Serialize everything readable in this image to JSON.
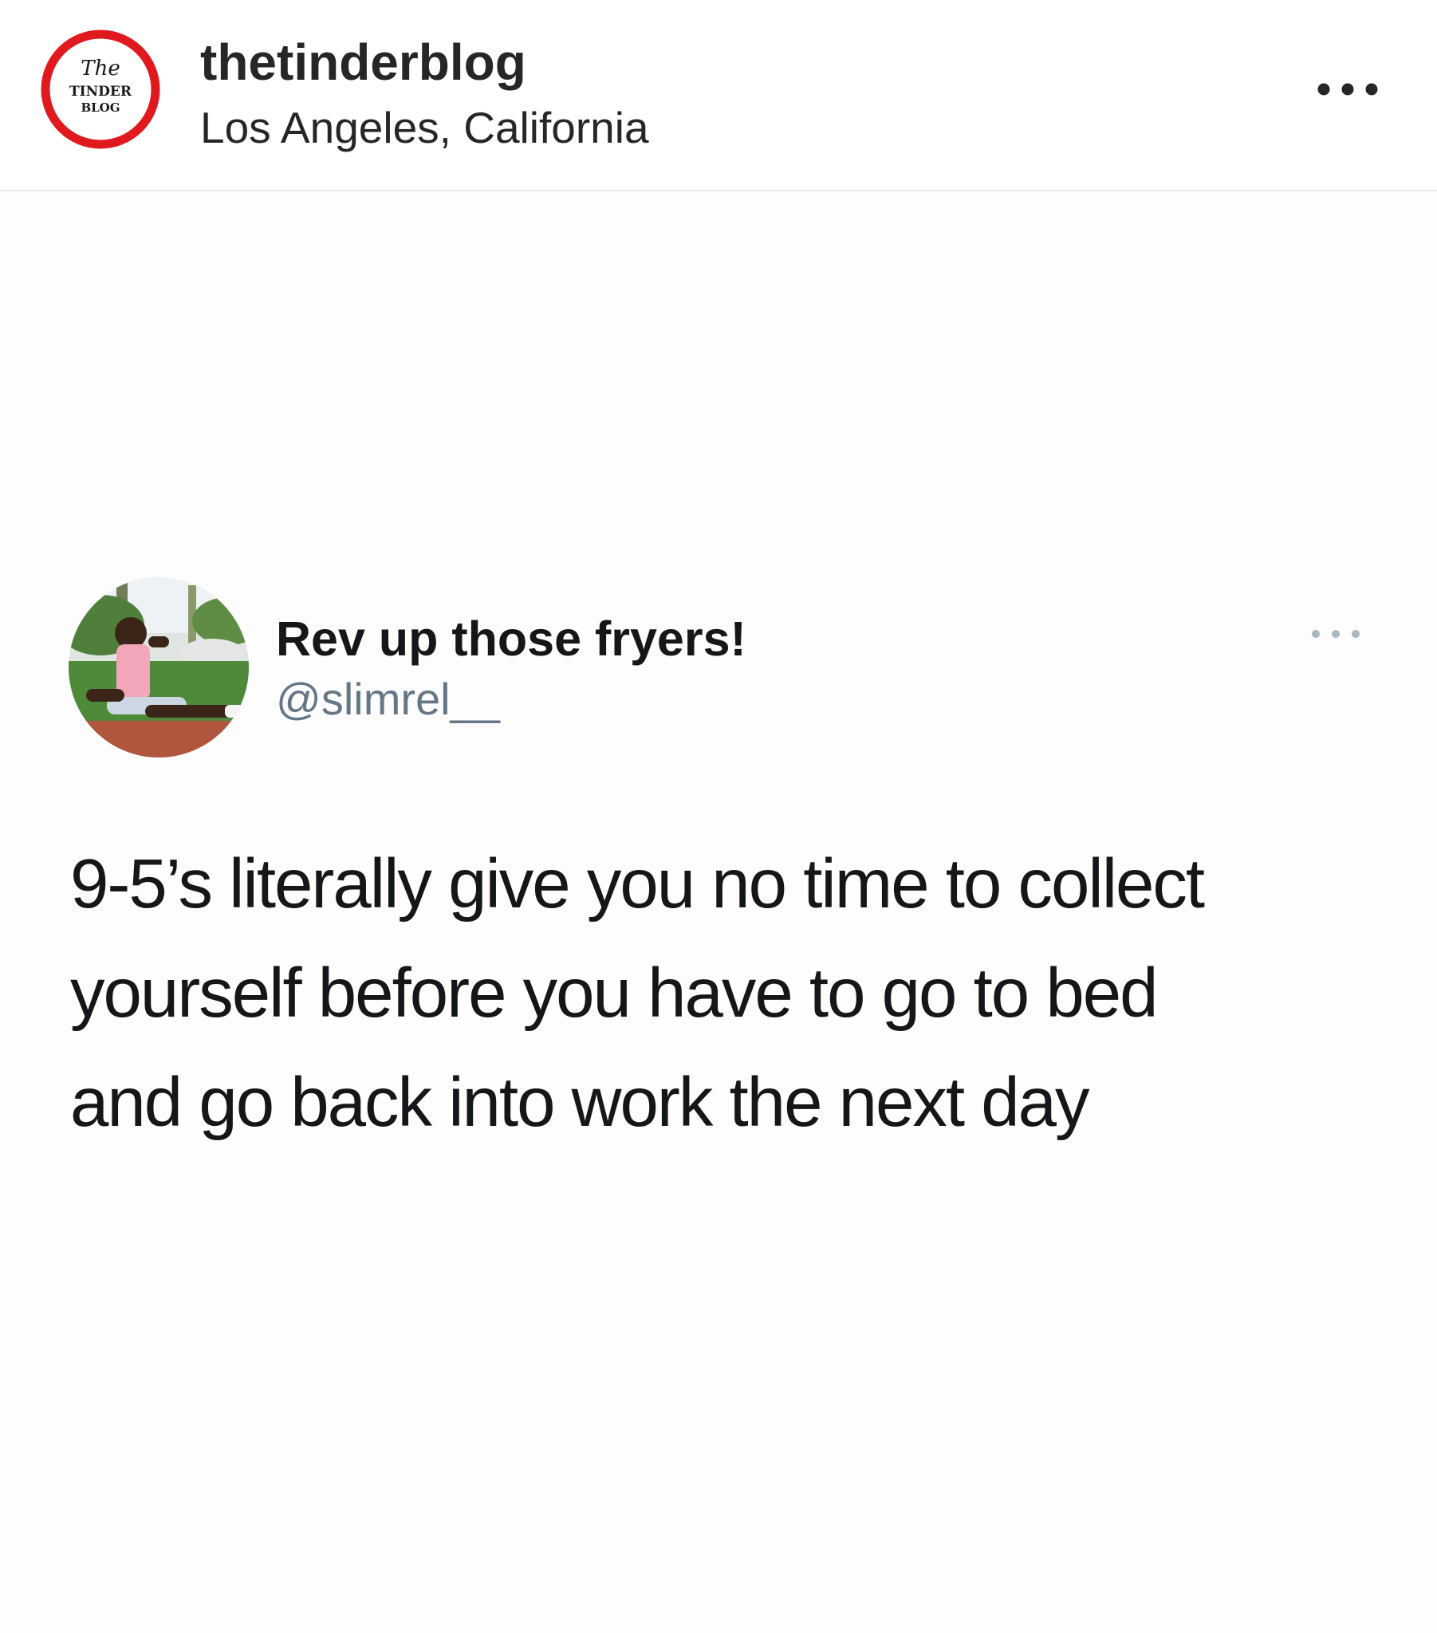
{
  "post": {
    "account": {
      "username": "thetinderblog",
      "location": "Los Angeles, California",
      "avatar": {
        "logo_text_top": "The",
        "logo_text_middle": "TINDER",
        "logo_text_bottom": "BLOG",
        "ring_color": "#e0191f"
      }
    },
    "options_icon": "more-horizontal-icon"
  },
  "tweet": {
    "display_name": "Rev up those fryers!",
    "handle": "@slimrel__",
    "options_icon": "more-horizontal-icon",
    "text_lines": [
      "9-5’s literally give you no time to collect",
      "yourself before you have to go to bed",
      "and go back into work the next day"
    ],
    "colors": {
      "name": "#14171a",
      "handle": "#657786",
      "body": "#14171a"
    }
  }
}
